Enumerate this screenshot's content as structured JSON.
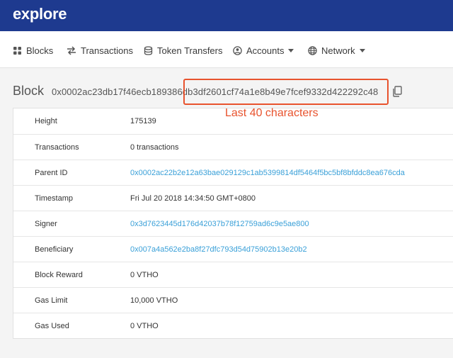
{
  "header": {
    "brand": "explore"
  },
  "nav": {
    "items": [
      {
        "label": "Blocks",
        "icon": "blocks-icon"
      },
      {
        "label": "Transactions",
        "icon": "transfer-arrows-icon"
      },
      {
        "label": "Token Transfers",
        "icon": "coins-icon"
      },
      {
        "label": "Accounts",
        "icon": "account-circle-icon",
        "dropdown": true
      },
      {
        "label": "Network",
        "icon": "globe-icon",
        "dropdown": true
      }
    ]
  },
  "block": {
    "label": "Block",
    "hash": "0x0002ac23db17f46ecb189386db3df2601cf74a1e8b49e7fcef9332d422292c48"
  },
  "annotation": {
    "text": "Last 40 characters",
    "color": "#e8532e"
  },
  "details": [
    {
      "label": "Height",
      "value": "175139",
      "link": false
    },
    {
      "label": "Transactions",
      "value": "0 transactions",
      "link": false
    },
    {
      "label": "Parent ID",
      "value": "0x0002ac22b2e12a63bae029129c1ab5399814df5464f5bc5bf8bfddc8ea676cda",
      "link": true
    },
    {
      "label": "Timestamp",
      "value": "Fri Jul 20 2018 14:34:50 GMT+0800",
      "link": false
    },
    {
      "label": "Signer",
      "value": "0x3d7623445d176d42037b78f12759ad6c9e5ae800",
      "link": true
    },
    {
      "label": "Beneficiary",
      "value": "0x007a4a562e2ba8f27dfc793d54d75902b13e20b2",
      "link": true
    },
    {
      "label": "Block Reward",
      "value": "0 VTHO",
      "link": false
    },
    {
      "label": "Gas Limit",
      "value": "10,000 VTHO",
      "link": false
    },
    {
      "label": "Gas Used",
      "value": "0 VTHO",
      "link": false
    }
  ],
  "colors": {
    "header": "#1e3a8f",
    "link": "#3aa0d8",
    "accent": "#e8532e"
  }
}
